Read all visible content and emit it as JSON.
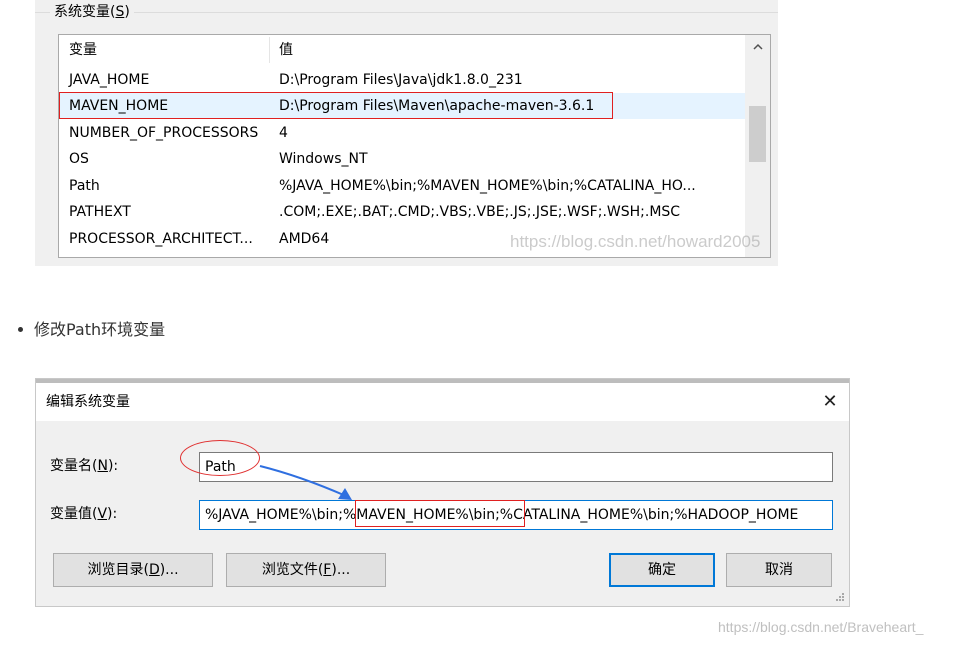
{
  "system_vars": {
    "group_label": "系统变量",
    "group_label_key": "S",
    "col_name": "变量",
    "col_value": "值",
    "rows": [
      {
        "name": "JAVA_HOME",
        "value": "D:\\Program Files\\Java\\jdk1.8.0_231"
      },
      {
        "name": "MAVEN_HOME",
        "value": "D:\\Program Files\\Maven\\apache-maven-3.6.1"
      },
      {
        "name": "NUMBER_OF_PROCESSORS",
        "value": "4"
      },
      {
        "name": "OS",
        "value": "Windows_NT"
      },
      {
        "name": "Path",
        "value": "%JAVA_HOME%\\bin;%MAVEN_HOME%\\bin;%CATALINA_HO..."
      },
      {
        "name": "PATHEXT",
        "value": ".COM;.EXE;.BAT;.CMD;.VBS;.VBE;.JS;.JSE;.WSF;.WSH;.MSC"
      },
      {
        "name": "PROCESSOR_ARCHITECT...",
        "value": "AMD64"
      }
    ],
    "watermark": "https://blog.csdn.net/howard2005"
  },
  "bullet": {
    "text": "修改Path环境变量"
  },
  "edit_dialog": {
    "title": "编辑系统变量",
    "close_glyph": "✕",
    "name_label": "变量名",
    "name_label_key": "N",
    "name_value": "Path",
    "value_label": "变量值",
    "value_label_key": "V",
    "value_value": "%JAVA_HOME%\\bin;%MAVEN_HOME%\\bin;%CATALINA_HOME%\\bin;%HADOOP_HOME",
    "browse_dir_label": "浏览目录",
    "browse_dir_key": "D",
    "browse_file_label": "浏览文件",
    "browse_file_key": "F",
    "ok_label": "确定",
    "cancel_label": "取消",
    "accent": "#0078d7",
    "highlight_color": "#e02020"
  },
  "footer": {
    "watermark": "https://blog.csdn.net/Braveheart_"
  }
}
